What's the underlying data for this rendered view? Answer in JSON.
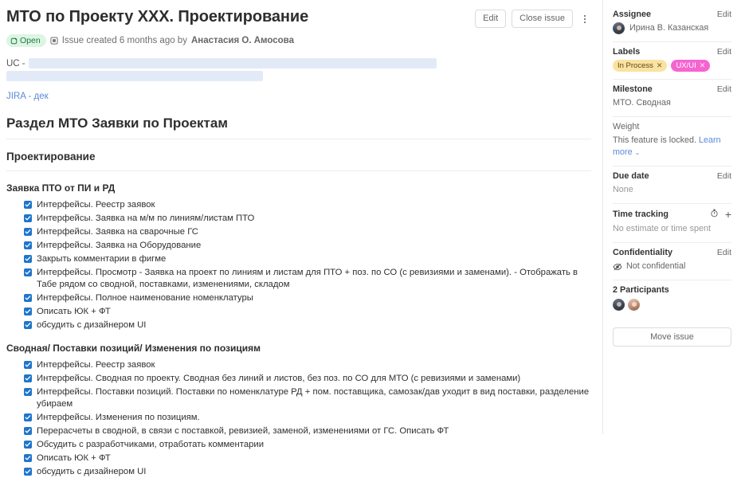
{
  "header": {
    "title": "МТО по Проекту ХХХ. Проектирование",
    "edit_label": "Edit",
    "close_label": "Close issue",
    "status_badge": "Open",
    "meta_prefix": "Issue created 6 months ago by",
    "author": "Анастасия О. Амосова",
    "status_color": "#ddf5e3",
    "status_text_color": "#217645"
  },
  "description": {
    "uc_label": "UC -",
    "jira_link": "JIRA - дек"
  },
  "content": {
    "section_title": "Раздел МТО Заявки по Проектам",
    "subsection_title": "Проектирование",
    "groups": [
      {
        "title": "Заявка ПТО от ПИ и РД",
        "items": [
          "Интерфейсы. Реестр заявок",
          "Интерфейсы. Заявка на м/м по линиям/листам ПТО",
          "Интерфейсы. Заявка на сварочные ГС",
          "Интерфейсы. Заявка на Оборудование",
          "Закрыть комментарии в фигме",
          "Интерфейсы. Просмотр - Заявка на проект по линиям и листам для ПТО + поз. по СО (с ревизиями и заменами). - Отображать в Табе рядом со сводной, поставками, изменениями, складом",
          "Интерфейсы. Полное наименование номенклатуры",
          "Описать ЮК + ФТ",
          "обсудить с дизайнером UI"
        ]
      },
      {
        "title": "Сводная/ Поставки позиций/ Изменения по позициям",
        "items": [
          "Интерфейсы. Реестр заявок",
          "Интерфейсы. Сводная по проекту. Сводная без линий и листов, без поз. по СО для МТО (с ревизиями и заменами)",
          "Интерфейсы. Поставки позиций. Поставки по номенклатуре РД + пом. поставщика, самозак/дав уходит в вид поставки, разделение убираем",
          "Интерфейсы. Изменения по позициям.",
          "Перерасчеты в сводной, в связи с поставкой, ревизией, заменой, изменениями от ГС. Описать ФТ",
          "Обсудить с разработчиками, отработать комментарии",
          "Описать ЮК + ФТ",
          "обсудить с дизайнером UI"
        ]
      }
    ]
  },
  "sidebar": {
    "assignee": {
      "title": "Assignee",
      "edit_label": "Edit",
      "name": "Ирина В. Казанская"
    },
    "labels": {
      "title": "Labels",
      "edit_label": "Edit",
      "items": [
        {
          "name": "In Process",
          "bg": "#fae3a0",
          "fg": "#5c4813",
          "remove": "✕"
        },
        {
          "name": "UX/UI",
          "bg": "#f664cf",
          "fg": "#ffffff",
          "remove": "✕"
        }
      ]
    },
    "milestone": {
      "title": "Milestone",
      "edit_label": "Edit",
      "value": "МТО. Сводная"
    },
    "weight": {
      "title": "Weight",
      "value": "This feature is locked.",
      "learn_more": "Learn more",
      "chevron": "⌄"
    },
    "due_date": {
      "title": "Due date",
      "edit_label": "Edit",
      "value": "None"
    },
    "time_tracking": {
      "title": "Time tracking",
      "value": "No estimate or time spent",
      "plus": "+"
    },
    "confidentiality": {
      "title": "Confidentiality",
      "edit_label": "Edit",
      "value": "Not confidential"
    },
    "participants": {
      "title": "2 Participants"
    },
    "move_issue_label": "Move issue"
  }
}
